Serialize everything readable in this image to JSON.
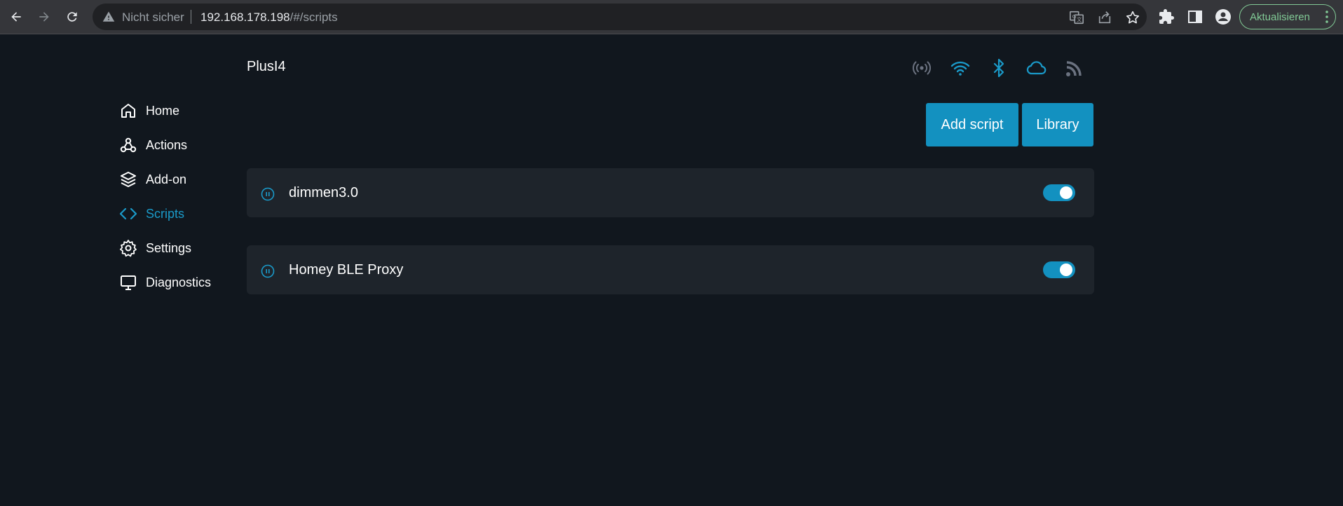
{
  "browser": {
    "security_label": "Nicht sicher",
    "url_host": "192.168.178.198",
    "url_path": "/#/scripts",
    "update_label": "Aktualisieren"
  },
  "app": {
    "device_name": "PlusI4",
    "status_icons": [
      "mqtt-icon",
      "wifi-icon",
      "bluetooth-icon",
      "cloud-icon",
      "rss-icon"
    ],
    "colors": {
      "accent": "#1391c0",
      "active_nav": "#1a9ac9",
      "background": "#11171e",
      "card": "#1e242b"
    }
  },
  "sidebar": {
    "items": [
      {
        "label": "Home",
        "icon": "home-icon",
        "active": false
      },
      {
        "label": "Actions",
        "icon": "actions-icon",
        "active": false
      },
      {
        "label": "Add-on",
        "icon": "layers-icon",
        "active": false
      },
      {
        "label": "Scripts",
        "icon": "code-icon",
        "active": true
      },
      {
        "label": "Settings",
        "icon": "gear-icon",
        "active": false
      },
      {
        "label": "Diagnostics",
        "icon": "monitor-icon",
        "active": false
      }
    ]
  },
  "toolbar": {
    "add_script_label": "Add script",
    "library_label": "Library"
  },
  "scripts": [
    {
      "name": "dimmen3.0",
      "enabled": true
    },
    {
      "name": "Homey BLE Proxy",
      "enabled": true
    }
  ]
}
